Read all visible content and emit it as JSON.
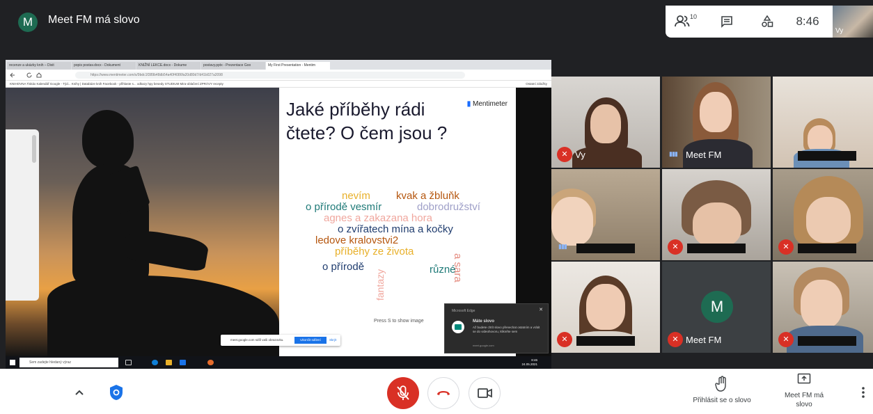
{
  "meeting": {
    "avatar_letter": "M",
    "title": "Meet FM má slovo"
  },
  "top_panel": {
    "participant_count": "10",
    "clock": "8:46",
    "self_label": "Vy"
  },
  "browser": {
    "tabs": [
      "recenze a ukázky knih – Dixit",
      "popis postav.docx - Dokument",
      "KNIŽNÍ LEKCE.docx - Dokume",
      "postavy.pptx - Prezentace Goo",
      "My First Presentation - Mentim"
    ],
    "url": "https://www.mentimeter.com/s/9bdc1f389b48db54a40f4086fa20d80d7/d41b027a2098",
    "bookmarks": "KNIHOVNA   Tiskáx   Kalendář Google - Týd...   Knihy | Databáze knih   Facebook - přihlaste s...   odkazy   hpy   besedy   STUDIUM   Mira-oblačení   ZPRÁVY   recepty",
    "bookmarks_right": "Ostatní záložky"
  },
  "slide": {
    "question": "Jaké příběhy rádi čtete? O čem jsou ?",
    "logo_text": "Mentimeter",
    "hint": "Press S to show image",
    "words": [
      "nevím",
      "kvak a žbluňk",
      "o přírodě vesmír",
      "dobrodružství",
      "agnes a zakazana hora",
      "o zvířatech mína a kočky",
      "ledove kralovstvi2",
      "příběhy ze života",
      "a sara",
      "o přírodě",
      "různé",
      "fantazy"
    ]
  },
  "edge_popup": {
    "header": "Microsoft Edge",
    "title": "Máte slovo",
    "text": "Až budete chtít slovo přenechat ostatním a vrátit se do videohovoru, klikněte sem",
    "source": "meet.google.com"
  },
  "share_bar": {
    "text": "meet.google.com sdílí vaši obrazovku.",
    "stop_label": "Ukončit sdílení",
    "hide_label": "Skrýt"
  },
  "taskbar": {
    "search_placeholder": "Sem zadejte hledaný výraz",
    "time": "8:46",
    "date": "24.05.2021"
  },
  "participants": [
    {
      "name": "Vy"
    },
    {
      "name": "Meet FM"
    },
    {
      "name": "Meet FM",
      "avatar_letter": "M"
    }
  ],
  "controls": {
    "raise_hand_label": "Přihlásit se o slovo",
    "present_label": "Meet FM má slovo"
  },
  "colors": {
    "mic_off": "#d93025",
    "avatar": "#1e6b52",
    "accent": "#1a73e8"
  }
}
